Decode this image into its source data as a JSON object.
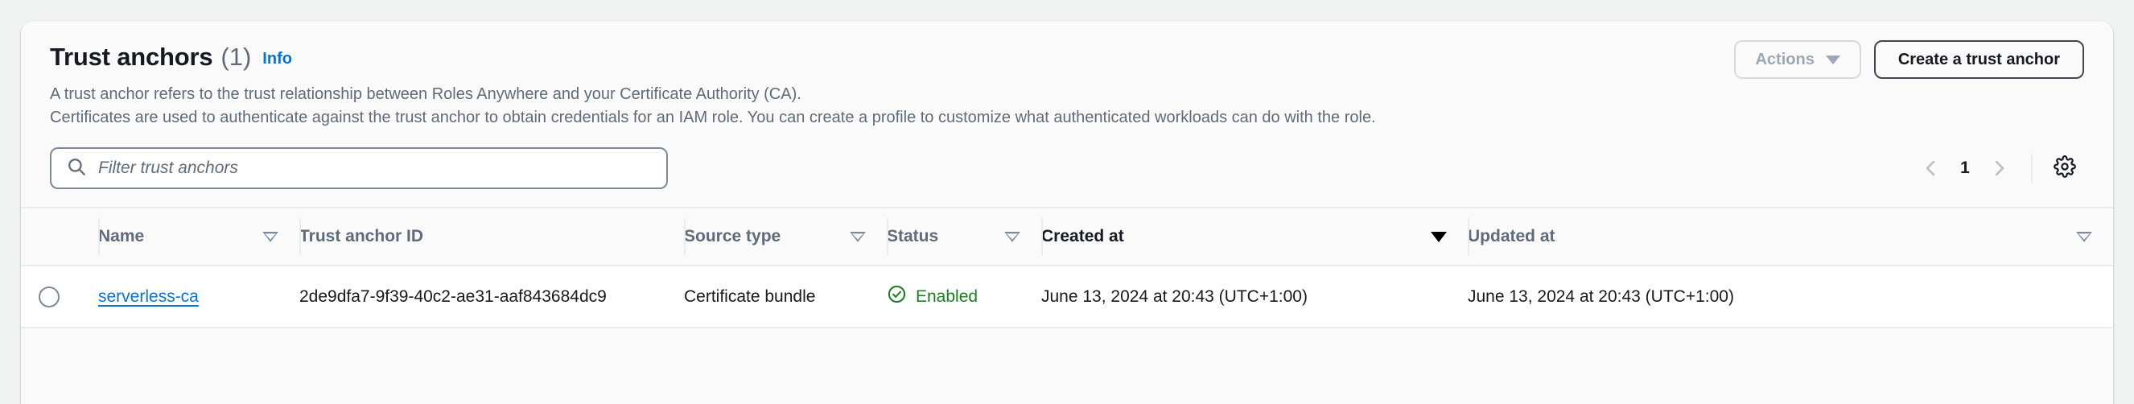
{
  "header": {
    "title": "Trust anchors",
    "count": "(1)",
    "info_label": "Info",
    "description_line_1": "A trust anchor refers to the trust relationship between Roles Anywhere and your Certificate Authority (CA).",
    "description_line_2": "Certificates are used to authenticate against the trust anchor to obtain credentials for an IAM role. You can create a profile to customize what authenticated workloads can do with the role.",
    "actions_button": "Actions",
    "create_button": "Create a trust anchor"
  },
  "filter": {
    "placeholder": "Filter trust anchors",
    "value": ""
  },
  "pagination": {
    "prev_label": "Previous page",
    "page_number": "1",
    "next_label": "Next page",
    "settings_label": "Preferences"
  },
  "table": {
    "columns": [
      {
        "label": "Name",
        "sort": "hollow"
      },
      {
        "label": "Trust anchor ID",
        "sort": "none"
      },
      {
        "label": "Source type",
        "sort": "hollow"
      },
      {
        "label": "Status",
        "sort": "hollow"
      },
      {
        "label": "Created at",
        "sort": "solid"
      },
      {
        "label": "Updated at",
        "sort": "hollow"
      }
    ],
    "rows": [
      {
        "name": "serverless-ca",
        "trust_anchor_id": "2de9dfa7-9f39-40c2-ae31-aaf843684dc9",
        "source_type": "Certificate bundle",
        "status": "Enabled",
        "status_icon": "check-circle-icon",
        "created_at": "June 13, 2024 at 20:43 (UTC+1:00)",
        "updated_at": "June 13, 2024 at 20:43 (UTC+1:00)"
      }
    ]
  },
  "colors": {
    "link": "#0972d3",
    "status_enabled": "#1d7d23",
    "border": "#e9ebed",
    "muted_text": "#5f6b7a"
  }
}
